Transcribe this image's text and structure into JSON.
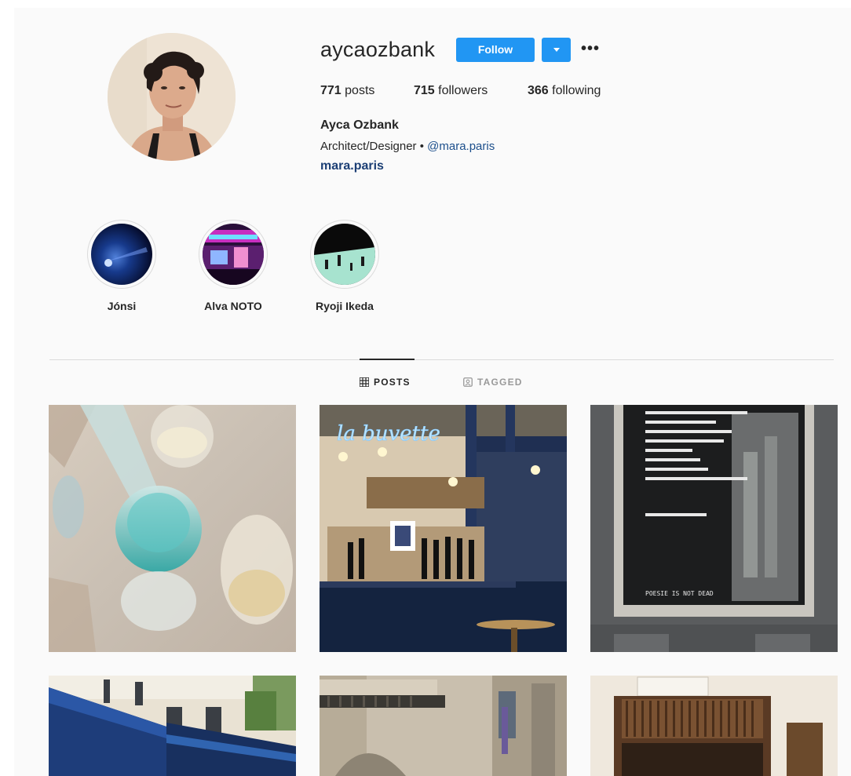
{
  "profile": {
    "username": "aycaozbank",
    "follow_label": "Follow",
    "more_label": "•••",
    "stats": {
      "posts_count": "771",
      "posts_label": "posts",
      "followers_count": "715",
      "followers_label": "followers",
      "following_count": "366",
      "following_label": "following"
    },
    "full_name": "Ayca Ozbank",
    "bio_text": "Architect/Designer • ",
    "bio_mention": "@mara.paris",
    "website": "mara.paris"
  },
  "highlights": [
    {
      "label": "Jónsi"
    },
    {
      "label": "Alva NOTO"
    },
    {
      "label": "Ryoji Ikeda"
    }
  ],
  "tabs": [
    {
      "label": "POSTS",
      "icon": "grid-icon",
      "active": true
    },
    {
      "label": "TAGGED",
      "icon": "tag-icon",
      "active": false
    }
  ],
  "posts": [
    {
      "text": ""
    },
    {
      "text": "la buvette"
    },
    {
      "text": "POESIE IS NOT DEAD"
    }
  ],
  "colors": {
    "accent": "#2196f3",
    "link": "#1c3f75",
    "text": "#262626",
    "muted": "#999999",
    "background": "#fafafa"
  }
}
